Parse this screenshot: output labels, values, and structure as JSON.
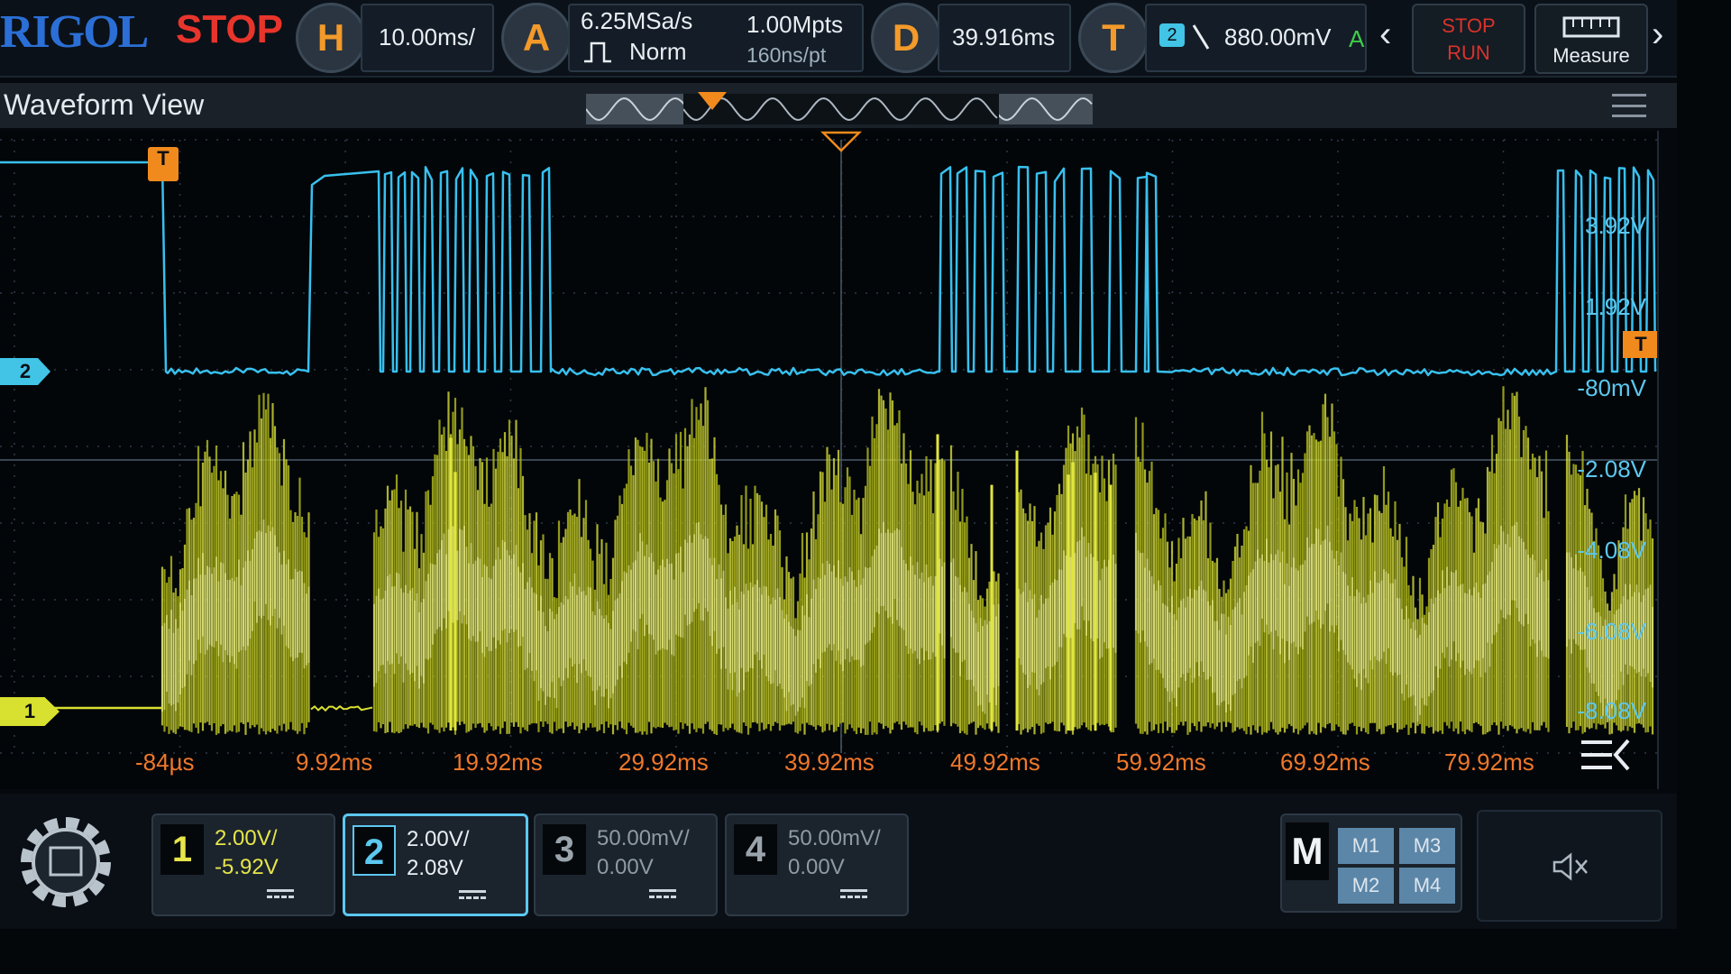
{
  "topbar": {
    "brand": "RIGOL",
    "run_state": "STOP",
    "horizontal": {
      "key": "H",
      "timebase": "10.00ms/"
    },
    "acquire": {
      "key": "A",
      "sample_rate": "6.25MSa/s",
      "memory_depth": "1.00Mpts",
      "mode": "Norm",
      "resolution": "160ns/pt"
    },
    "delay": {
      "key": "D",
      "value": "39.916ms"
    },
    "trigger": {
      "key": "T",
      "source": "2",
      "level": "880.00mV",
      "status": "A"
    },
    "stop_run_button": {
      "line1": "STOP",
      "line2": "RUN"
    },
    "measure_button": "Measure",
    "nav_left": "‹",
    "nav_right": "›"
  },
  "waveform": {
    "title": "Waveform View",
    "trigger_marker": "T",
    "channel_markers": {
      "ch1": "1",
      "ch2": "2"
    },
    "time_labels": [
      "-84µs",
      "9.92ms",
      "19.92ms",
      "29.92ms",
      "39.92ms",
      "49.92ms",
      "59.92ms",
      "69.92ms",
      "79.92ms"
    ],
    "voltage_labels": [
      "3.92V",
      "1.92V",
      "-80mV",
      "-2.08V",
      "-4.08V",
      "-6.08V",
      "-8.08V"
    ],
    "colors": {
      "ch1": "#d8e030",
      "ch2": "#38c0ee",
      "trigger": "#f08a1d",
      "time_axis": "#f0782a"
    }
  },
  "channels": [
    {
      "num": "1",
      "scale": "2.00V/",
      "offset": "-5.92V",
      "color": "#e6e54a"
    },
    {
      "num": "2",
      "scale": "2.00V/",
      "offset": "2.08V",
      "color": "#5cc8f0"
    },
    {
      "num": "3",
      "scale": "50.00mV/",
      "offset": "0.00V",
      "color": "#9aa4ad"
    },
    {
      "num": "4",
      "scale": "50.00mV/",
      "offset": "0.00V",
      "color": "#9aa4ad"
    }
  ],
  "math": {
    "key": "M",
    "slots": [
      "M1",
      "M3",
      "M2",
      "M4"
    ]
  },
  "icons": {
    "settings": "gear-icon",
    "mute": "speaker-mute-icon",
    "menu": "hamburger-icon",
    "collapse": "collapse-menu-icon"
  }
}
